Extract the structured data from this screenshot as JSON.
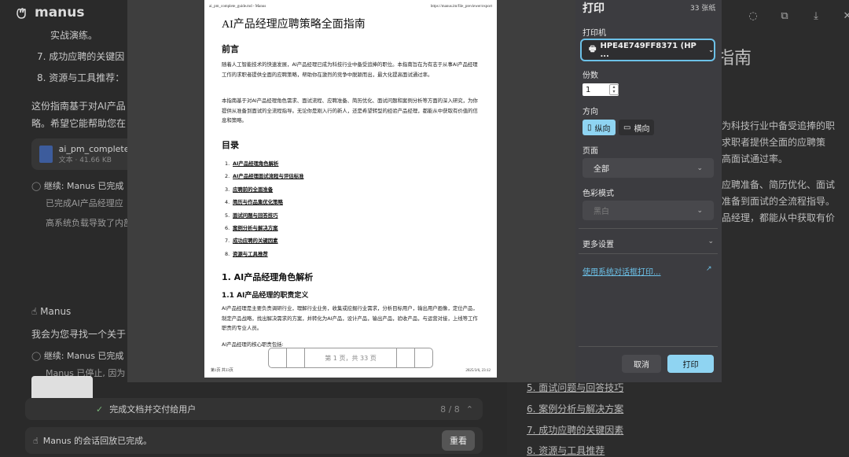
{
  "app": {
    "logo": "manus"
  },
  "left": {
    "line1": "实战演练。",
    "item7": "7.  成功应聘的关键因",
    "item8": "8.  资源与工具推荐：",
    "summary1": "这份指南基于对AI产品",
    "summary2": "略。希望它能帮助您在",
    "file": {
      "name": "ai_pm_complete_",
      "meta": "文本 · 41.66 KB"
    },
    "continue1": "继续:  Manus 已完成",
    "done1": "已完成AI产品经理应",
    "load1": "高系统负载导致了内部",
    "manus_label": "Manus",
    "find": "我会为您寻找一个关于",
    "continue2": "继续:  Manus 已完成",
    "stopped": "Manus 已停止, 因为",
    "progress": {
      "label": "完成文档并交付给用户",
      "count": "8 / 8"
    },
    "bottom": {
      "text": "Manus 的会话回放已完成。",
      "button": "重看"
    }
  },
  "right": {
    "title": "指南",
    "p1": "为科技行业中备受追捧的职",
    "p2": "求职者提供全面的应聘策",
    "p3": "高面试通过率。",
    "p4": "应聘准备、简历优化、面试",
    "p5": "准备到面试的全流程指导。",
    "p6": "品经理，都能从中获取有价",
    "toc": [
      "5.  面试问题与回答技巧",
      "6.  案例分析与解决方案",
      "7.  成功应聘的关键因素",
      "8.  资源与工具推荐"
    ]
  },
  "document": {
    "header_left": "ai_pm_complete_guide.md - Manus",
    "header_right": "https://manus.im/file_previewer/export",
    "title": "AI产品经理应聘策略全面指南",
    "preface_heading": "前言",
    "preface_p1": "随着人工智能技术的快速发展，AI产品经理已成为科技行业中备受追捧的职位。本指南旨在为有志于从事AI产品经理工作的求职者提供全面的应聘策略，帮助你在激烈的竞争中脱颖而出，最大化提高面试通过率。",
    "preface_p2": "本指南基于对AI产品经理角色需求、面试流程、应聘准备、简历优化、面试问题和案例分析等方面的深入研究，为你提供从准备到面试的全流程指导。无论你是刚入行的新人，还是希望转型的经验产品经理，都能从中获取有价值的信息和策略。",
    "toc_heading": "目录",
    "toc": [
      {
        "num": "1.",
        "text": "AI产品经理角色解析"
      },
      {
        "num": "2.",
        "text": "AI产品经理面试流程与评估标准"
      },
      {
        "num": "3.",
        "text": "应聘前的全面准备"
      },
      {
        "num": "4.",
        "text": "简历与作品集优化策略"
      },
      {
        "num": "5.",
        "text": "面试问题与回答技巧"
      },
      {
        "num": "6.",
        "text": "案例分析与解决方案"
      },
      {
        "num": "7.",
        "text": "成功应聘的关键因素"
      },
      {
        "num": "8.",
        "text": "资源与工具推荐"
      }
    ],
    "section1": "1. AI产品经理角色解析",
    "section1_1": "1.1 AI产品经理的职责定义",
    "body": "AI产品经理是主要负责调研行业，理解行业业务，收集或挖掘行业需求，分析目标用户，输出用户画像，定位产品，制定产品战略，找出解决需求的方案，并转化为AI产品，设计产品，输出产品，验收产品，与运营对接，上线等工作职责的专业人员。",
    "list_intro": "AI产品经理的核心职责包括:",
    "footer_left": "第1页 共33页",
    "footer_right": "2025/3/6, 23:12",
    "pager": "第 1 页，共 33 页"
  },
  "print_panel": {
    "title": "打印",
    "sheets": "33 张纸",
    "printer_label": "打印机",
    "printer": "HPE4E749FF8371 (HP ...",
    "copies_label": "份数",
    "copies": "1",
    "orientation_label": "方向",
    "portrait": "纵向",
    "landscape": "横向",
    "pages_label": "页面",
    "pages": "全部",
    "color_label": "色彩模式",
    "color": "黑白",
    "more": "更多设置",
    "system_dialog": "使用系统对话框打印...",
    "cancel": "取消",
    "print": "打印"
  },
  "colors": {
    "accent": "#8fd4f2",
    "link": "#6cc1e8",
    "panel": "#3c3c40"
  }
}
